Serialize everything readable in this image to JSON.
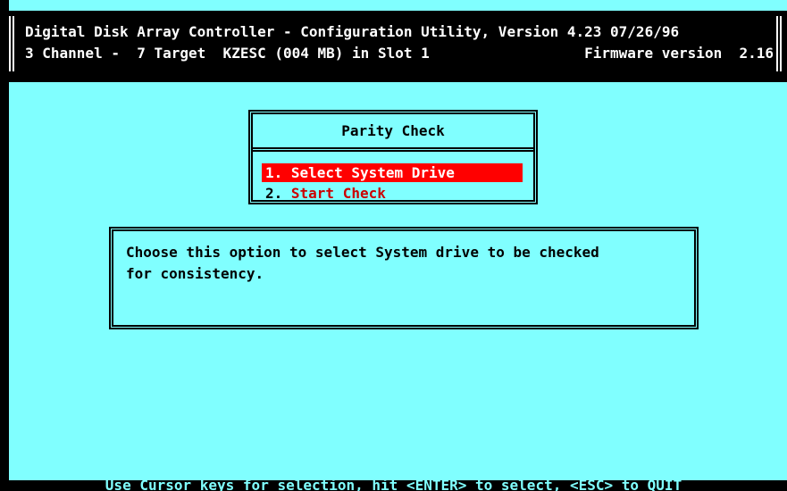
{
  "header": {
    "line1_left": "Digital Disk Array Controller - Configuration Utility, Version 4.23 07/26/96",
    "line2_left": "3 Channel -  7 Target  KZESC (004 MB) in Slot 1",
    "line2_right": "Firmware version  2.16"
  },
  "menu": {
    "title": "Parity Check",
    "items": [
      {
        "number": "1.",
        "label": " Select System Drive",
        "selected": true
      },
      {
        "number": "2.",
        "label": " Start Check",
        "selected": false
      }
    ]
  },
  "help": {
    "text": "Choose this option to select System drive to be checked\nfor consistency."
  },
  "status_bar": {
    "text": "Use Cursor keys for selection, hit <ENTER> to select, <ESC> to QUIT"
  },
  "colors": {
    "background": "#80ffff",
    "header_bg": "#000000",
    "selection_bg": "#ff0000",
    "menu_text_unselected": "#cc0000"
  }
}
